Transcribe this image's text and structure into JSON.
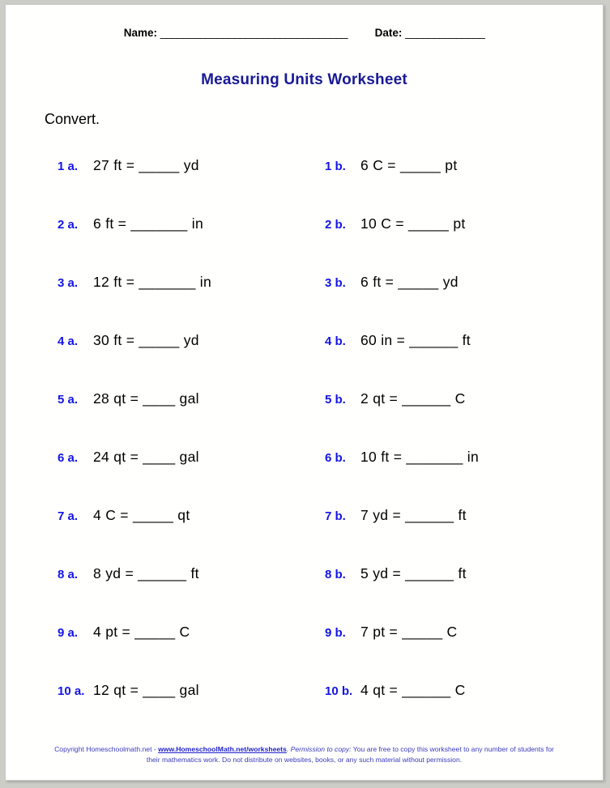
{
  "header": {
    "name_label": "Name:",
    "name_rule": "_________________________________",
    "date_label": "Date:",
    "date_rule": "______________"
  },
  "title": "Measuring Units Worksheet",
  "instruction": "Convert.",
  "problems": [
    {
      "a_label": "1 a.",
      "a_text": "27 ft  =  _____ yd",
      "b_label": "1 b.",
      "b_text": "6 C  =  _____ pt"
    },
    {
      "a_label": "2 a.",
      "a_text": "6 ft  =  _______ in",
      "b_label": "2 b.",
      "b_text": "10 C  =  _____ pt"
    },
    {
      "a_label": "3 a.",
      "a_text": "12 ft  =  _______ in",
      "b_label": "3 b.",
      "b_text": "6 ft  =  _____ yd"
    },
    {
      "a_label": "4 a.",
      "a_text": "30 ft  =  _____ yd",
      "b_label": "4 b.",
      "b_text": "60 in  =  ______ ft"
    },
    {
      "a_label": "5 a.",
      "a_text": "28 qt  =  ____ gal",
      "b_label": "5 b.",
      "b_text": "2 qt  =  ______ C"
    },
    {
      "a_label": "6 a.",
      "a_text": "24 qt  =  ____ gal",
      "b_label": "6 b.",
      "b_text": "10 ft  =  _______ in"
    },
    {
      "a_label": "7 a.",
      "a_text": "4 C  =  _____ qt",
      "b_label": "7 b.",
      "b_text": "7 yd  =  ______ ft"
    },
    {
      "a_label": "8 a.",
      "a_text": "8 yd  =  ______ ft",
      "b_label": "8 b.",
      "b_text": "5 yd  =  ______ ft"
    },
    {
      "a_label": "9 a.",
      "a_text": "4 pt  =  _____ C",
      "b_label": "9 b.",
      "b_text": "7 pt  =  _____ C"
    },
    {
      "a_label": "10 a.",
      "a_text": "12 qt  =  ____ gal",
      "b_label": "10 b.",
      "b_text": "4 qt  =  ______ C"
    }
  ],
  "footer": {
    "copyright": "Copyright Homeschoolmath.net - ",
    "link": "www.HomeschoolMath.net/worksheets",
    "permission_label": ".  Permission to copy:",
    "permission_text": " You are free to copy this worksheet to any number of students for their mathematics work. Do not distribute on websites, books, or any such material without permission."
  },
  "colors": {
    "title": "#191997",
    "label": "#1414e6",
    "footer": "#3b3bbf",
    "page": "#fffffd",
    "background": "#cdcdc8"
  }
}
